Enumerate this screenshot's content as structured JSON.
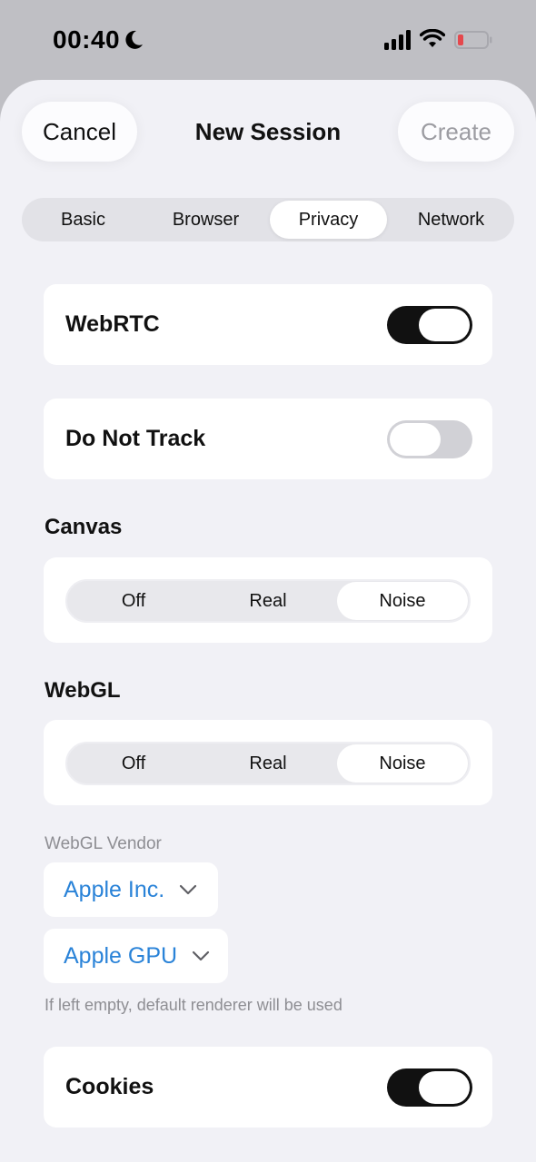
{
  "status_bar": {
    "time": "00:40",
    "icons": [
      "moon-icon",
      "cellular-signal-icon",
      "wifi-icon",
      "battery-low-icon"
    ],
    "battery_color": "#e5484d"
  },
  "nav": {
    "cancel_label": "Cancel",
    "title": "New Session",
    "create_label": "Create"
  },
  "tabs": [
    {
      "label": "Basic",
      "active": false
    },
    {
      "label": "Browser",
      "active": false
    },
    {
      "label": "Privacy",
      "active": true
    },
    {
      "label": "Network",
      "active": false
    }
  ],
  "settings": {
    "webrtc": {
      "label": "WebRTC",
      "enabled": true
    },
    "do_not_track": {
      "label": "Do Not Track",
      "enabled": false
    },
    "canvas": {
      "title": "Canvas",
      "options": [
        "Off",
        "Real",
        "Noise"
      ],
      "selected": "Noise"
    },
    "webgl": {
      "title": "WebGL",
      "options": [
        "Off",
        "Real",
        "Noise"
      ],
      "selected": "Noise"
    },
    "webgl_vendor": {
      "caption": "WebGL Vendor",
      "vendor_value": "Apple Inc.",
      "renderer_value": "Apple GPU",
      "hint": "If left empty, default renderer will be used"
    },
    "cookies": {
      "label": "Cookies",
      "enabled": true
    }
  },
  "colors": {
    "accent_blue": "#2a83d8",
    "toggle_on": "#111111",
    "toggle_off": "#d1d1d6",
    "sheet_bg": "#f1f1f6"
  }
}
